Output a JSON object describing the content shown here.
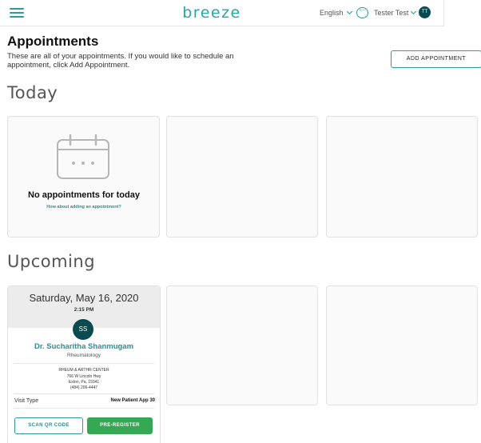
{
  "header": {
    "brand": "breeze",
    "language": "English",
    "user_name": "Tester Test",
    "user_initials": "TT"
  },
  "page": {
    "title": "Appointments",
    "description": "These are all of your appointments. If you would like to schedule an appointment, click Add Appointment.",
    "add_button": "ADD APPOINTMENT"
  },
  "today": {
    "heading": "Today",
    "empty_title": "No appointments for today",
    "empty_link": "How about adding an appointment?"
  },
  "upcoming": {
    "heading": "Upcoming",
    "appointments": [
      {
        "date": "Saturday, May 16, 2020",
        "time": "2:15 PM",
        "initials": "SS",
        "doctor": "Dr. Sucharitha Shanmugam",
        "specialty": "Rheumatology",
        "location_name": "RHEUM & ARTHR CENTER",
        "address_line1": "766 W Lincoln Hwy",
        "address_line2": "Exton, Pa, 19341",
        "phone": "(484) 206-4447",
        "visit_type_label": "Visit Type",
        "visit_type_value": "New Patient App 30",
        "scan_button": "SCAN QR CODE",
        "preregister_button": "PRE-REGISTER"
      }
    ]
  },
  "colors": {
    "accent": "#2b9c9a",
    "avatar": "#0b4a4f",
    "preregister": "#34a853",
    "card_bg": "#fafafa"
  },
  "icons": {
    "menu": "hamburger-icon",
    "chat": "chat-bubble-icon",
    "calendar": "calendar-icon"
  }
}
